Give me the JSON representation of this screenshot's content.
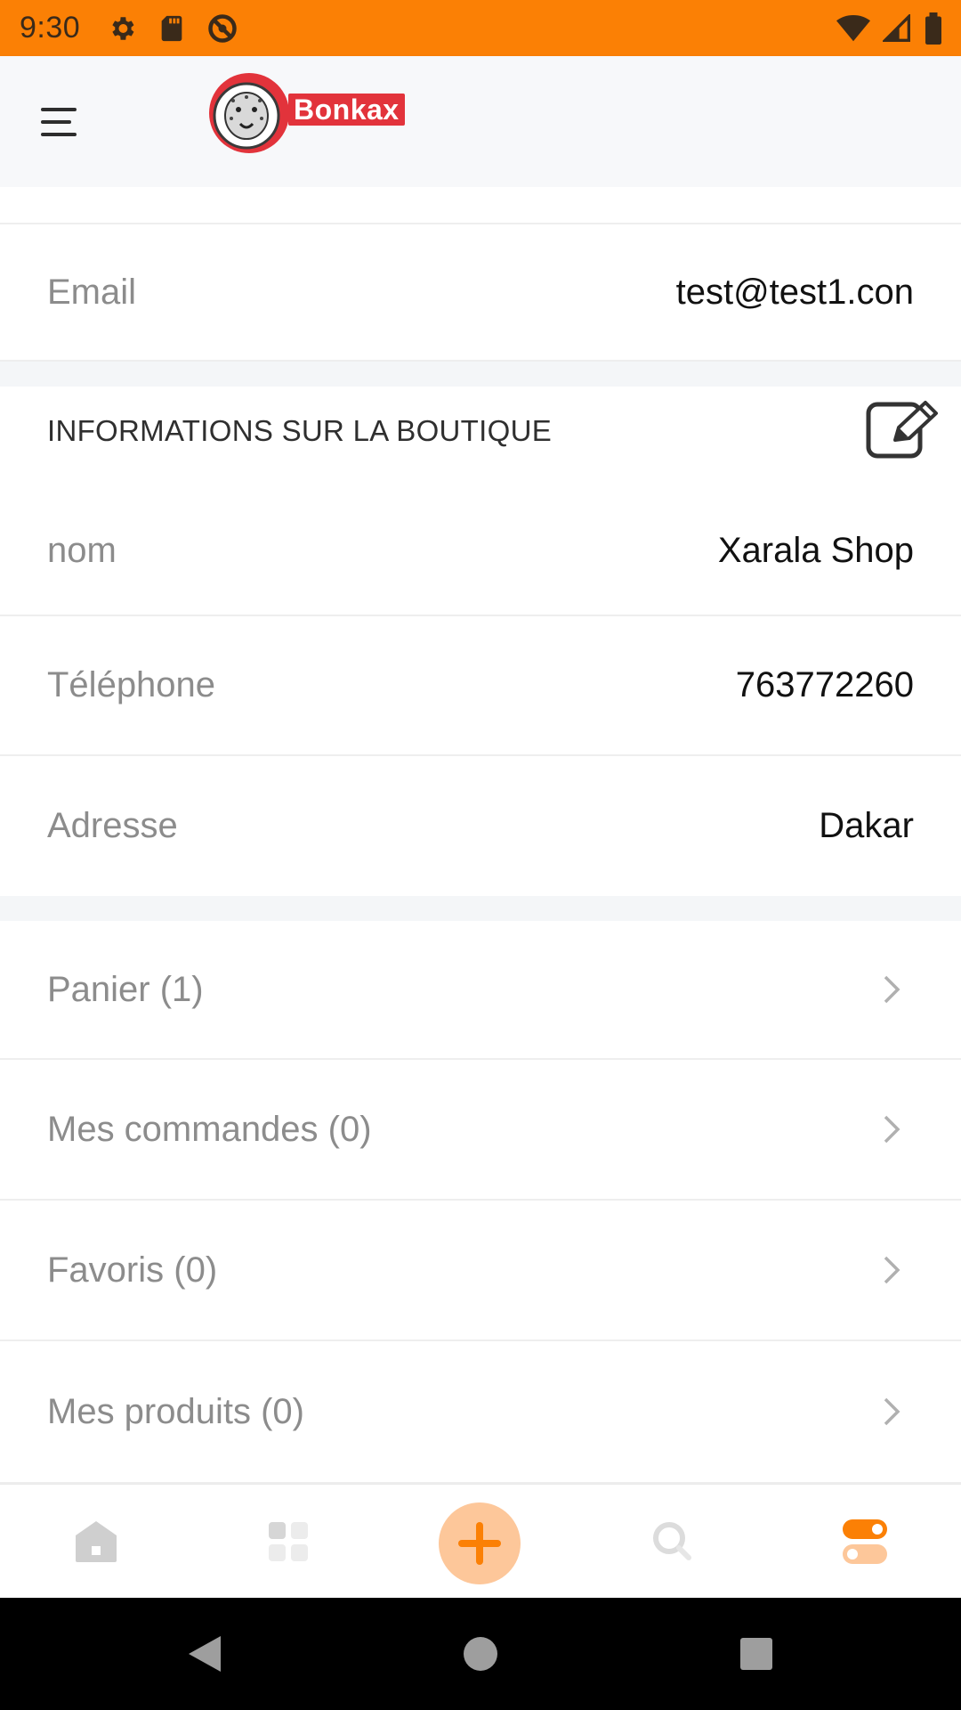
{
  "status_bar": {
    "time": "9:30",
    "icons_left": [
      "gear-icon",
      "sd-card-icon",
      "do-not-disturb-icon"
    ],
    "icons_right": [
      "wifi-icon",
      "signal-icon",
      "battery-icon"
    ]
  },
  "header": {
    "logo_text": "Bonkax",
    "icons": [
      "menu-icon"
    ]
  },
  "account": {
    "email_label": "Email",
    "email_value": "test@test1.con"
  },
  "shop_info": {
    "section_title": "INFORMATIONS SUR LA BOUTIQUE",
    "edit_icon": "edit-icon",
    "rows": [
      {
        "label": "nom",
        "value": "Xarala Shop"
      },
      {
        "label": "Téléphone",
        "value": "763772260"
      },
      {
        "label": "Adresse",
        "value": "Dakar"
      }
    ]
  },
  "menu_rows": [
    {
      "label": "Panier (1)"
    },
    {
      "label": "Mes commandes (0)"
    },
    {
      "label": "Favoris (0)"
    },
    {
      "label": "Mes produits (0)"
    }
  ],
  "bottom_nav": {
    "items": [
      "home-icon",
      "grid-icon",
      "add-icon",
      "search-icon",
      "toggle-icon"
    ],
    "active": "toggle-icon",
    "accent_color": "#fb8005"
  },
  "system_nav": [
    "back-icon",
    "home-circle-icon",
    "recents-icon"
  ],
  "colors": {
    "status_bar": "#fb8005",
    "logo_red": "#e2333b"
  }
}
